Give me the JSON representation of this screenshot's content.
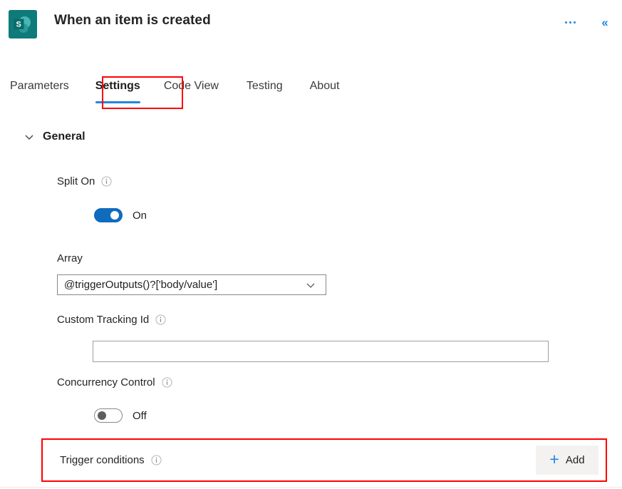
{
  "header": {
    "title": "When an item is created",
    "app_icon": "sharepoint-icon",
    "more_label": "...",
    "collapse_label": "«",
    "accent_color": "#0f6cbd",
    "icon_bg_color": "#127c7c"
  },
  "tabs": {
    "items": [
      {
        "label": "Parameters",
        "active": false
      },
      {
        "label": "Settings",
        "active": true
      },
      {
        "label": "Code View",
        "active": false
      },
      {
        "label": "Testing",
        "active": false
      },
      {
        "label": "About",
        "active": false
      }
    ],
    "active_underline_color": "#2186e0",
    "annotation_color": "#ff0000"
  },
  "section": {
    "title": "General",
    "expanded": true,
    "chevron": "chevron-down-icon"
  },
  "fields": {
    "split_on": {
      "label": "Split On",
      "info": "info-icon",
      "toggle_state": "on",
      "toggle_text": "On"
    },
    "array": {
      "label": "Array",
      "value": "@triggerOutputs()?['body/value']",
      "chevron": "chevron-down-icon"
    },
    "custom_tracking_id": {
      "label": "Custom Tracking Id",
      "info": "info-icon",
      "value": "",
      "placeholder": ""
    },
    "concurrency_control": {
      "label": "Concurrency Control",
      "info": "info-icon",
      "toggle_state": "off",
      "toggle_text": "Off"
    },
    "trigger_conditions": {
      "label": "Trigger conditions",
      "info": "info-icon",
      "add_label": "Add",
      "add_icon": "plus-icon"
    }
  }
}
